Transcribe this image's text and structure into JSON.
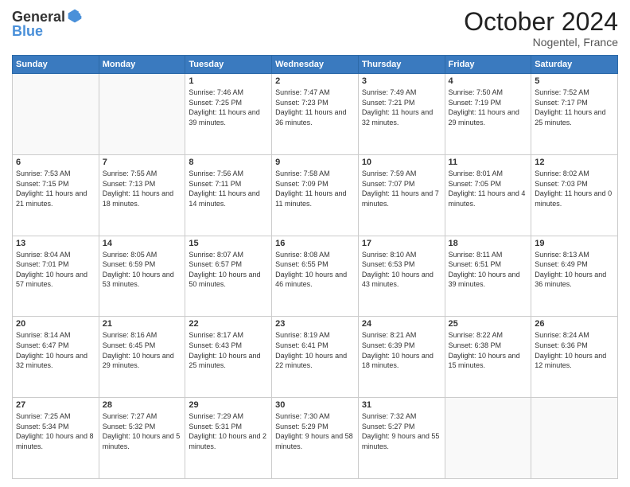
{
  "header": {
    "logo_general": "General",
    "logo_blue": "Blue",
    "month_title": "October 2024",
    "location": "Nogentel, France"
  },
  "days_of_week": [
    "Sunday",
    "Monday",
    "Tuesday",
    "Wednesday",
    "Thursday",
    "Friday",
    "Saturday"
  ],
  "weeks": [
    [
      {
        "day": "",
        "info": ""
      },
      {
        "day": "",
        "info": ""
      },
      {
        "day": "1",
        "info": "Sunrise: 7:46 AM\nSunset: 7:25 PM\nDaylight: 11 hours and 39 minutes."
      },
      {
        "day": "2",
        "info": "Sunrise: 7:47 AM\nSunset: 7:23 PM\nDaylight: 11 hours and 36 minutes."
      },
      {
        "day": "3",
        "info": "Sunrise: 7:49 AM\nSunset: 7:21 PM\nDaylight: 11 hours and 32 minutes."
      },
      {
        "day": "4",
        "info": "Sunrise: 7:50 AM\nSunset: 7:19 PM\nDaylight: 11 hours and 29 minutes."
      },
      {
        "day": "5",
        "info": "Sunrise: 7:52 AM\nSunset: 7:17 PM\nDaylight: 11 hours and 25 minutes."
      }
    ],
    [
      {
        "day": "6",
        "info": "Sunrise: 7:53 AM\nSunset: 7:15 PM\nDaylight: 11 hours and 21 minutes."
      },
      {
        "day": "7",
        "info": "Sunrise: 7:55 AM\nSunset: 7:13 PM\nDaylight: 11 hours and 18 minutes."
      },
      {
        "day": "8",
        "info": "Sunrise: 7:56 AM\nSunset: 7:11 PM\nDaylight: 11 hours and 14 minutes."
      },
      {
        "day": "9",
        "info": "Sunrise: 7:58 AM\nSunset: 7:09 PM\nDaylight: 11 hours and 11 minutes."
      },
      {
        "day": "10",
        "info": "Sunrise: 7:59 AM\nSunset: 7:07 PM\nDaylight: 11 hours and 7 minutes."
      },
      {
        "day": "11",
        "info": "Sunrise: 8:01 AM\nSunset: 7:05 PM\nDaylight: 11 hours and 4 minutes."
      },
      {
        "day": "12",
        "info": "Sunrise: 8:02 AM\nSunset: 7:03 PM\nDaylight: 11 hours and 0 minutes."
      }
    ],
    [
      {
        "day": "13",
        "info": "Sunrise: 8:04 AM\nSunset: 7:01 PM\nDaylight: 10 hours and 57 minutes."
      },
      {
        "day": "14",
        "info": "Sunrise: 8:05 AM\nSunset: 6:59 PM\nDaylight: 10 hours and 53 minutes."
      },
      {
        "day": "15",
        "info": "Sunrise: 8:07 AM\nSunset: 6:57 PM\nDaylight: 10 hours and 50 minutes."
      },
      {
        "day": "16",
        "info": "Sunrise: 8:08 AM\nSunset: 6:55 PM\nDaylight: 10 hours and 46 minutes."
      },
      {
        "day": "17",
        "info": "Sunrise: 8:10 AM\nSunset: 6:53 PM\nDaylight: 10 hours and 43 minutes."
      },
      {
        "day": "18",
        "info": "Sunrise: 8:11 AM\nSunset: 6:51 PM\nDaylight: 10 hours and 39 minutes."
      },
      {
        "day": "19",
        "info": "Sunrise: 8:13 AM\nSunset: 6:49 PM\nDaylight: 10 hours and 36 minutes."
      }
    ],
    [
      {
        "day": "20",
        "info": "Sunrise: 8:14 AM\nSunset: 6:47 PM\nDaylight: 10 hours and 32 minutes."
      },
      {
        "day": "21",
        "info": "Sunrise: 8:16 AM\nSunset: 6:45 PM\nDaylight: 10 hours and 29 minutes."
      },
      {
        "day": "22",
        "info": "Sunrise: 8:17 AM\nSunset: 6:43 PM\nDaylight: 10 hours and 25 minutes."
      },
      {
        "day": "23",
        "info": "Sunrise: 8:19 AM\nSunset: 6:41 PM\nDaylight: 10 hours and 22 minutes."
      },
      {
        "day": "24",
        "info": "Sunrise: 8:21 AM\nSunset: 6:39 PM\nDaylight: 10 hours and 18 minutes."
      },
      {
        "day": "25",
        "info": "Sunrise: 8:22 AM\nSunset: 6:38 PM\nDaylight: 10 hours and 15 minutes."
      },
      {
        "day": "26",
        "info": "Sunrise: 8:24 AM\nSunset: 6:36 PM\nDaylight: 10 hours and 12 minutes."
      }
    ],
    [
      {
        "day": "27",
        "info": "Sunrise: 7:25 AM\nSunset: 5:34 PM\nDaylight: 10 hours and 8 minutes."
      },
      {
        "day": "28",
        "info": "Sunrise: 7:27 AM\nSunset: 5:32 PM\nDaylight: 10 hours and 5 minutes."
      },
      {
        "day": "29",
        "info": "Sunrise: 7:29 AM\nSunset: 5:31 PM\nDaylight: 10 hours and 2 minutes."
      },
      {
        "day": "30",
        "info": "Sunrise: 7:30 AM\nSunset: 5:29 PM\nDaylight: 9 hours and 58 minutes."
      },
      {
        "day": "31",
        "info": "Sunrise: 7:32 AM\nSunset: 5:27 PM\nDaylight: 9 hours and 55 minutes."
      },
      {
        "day": "",
        "info": ""
      },
      {
        "day": "",
        "info": ""
      }
    ]
  ]
}
